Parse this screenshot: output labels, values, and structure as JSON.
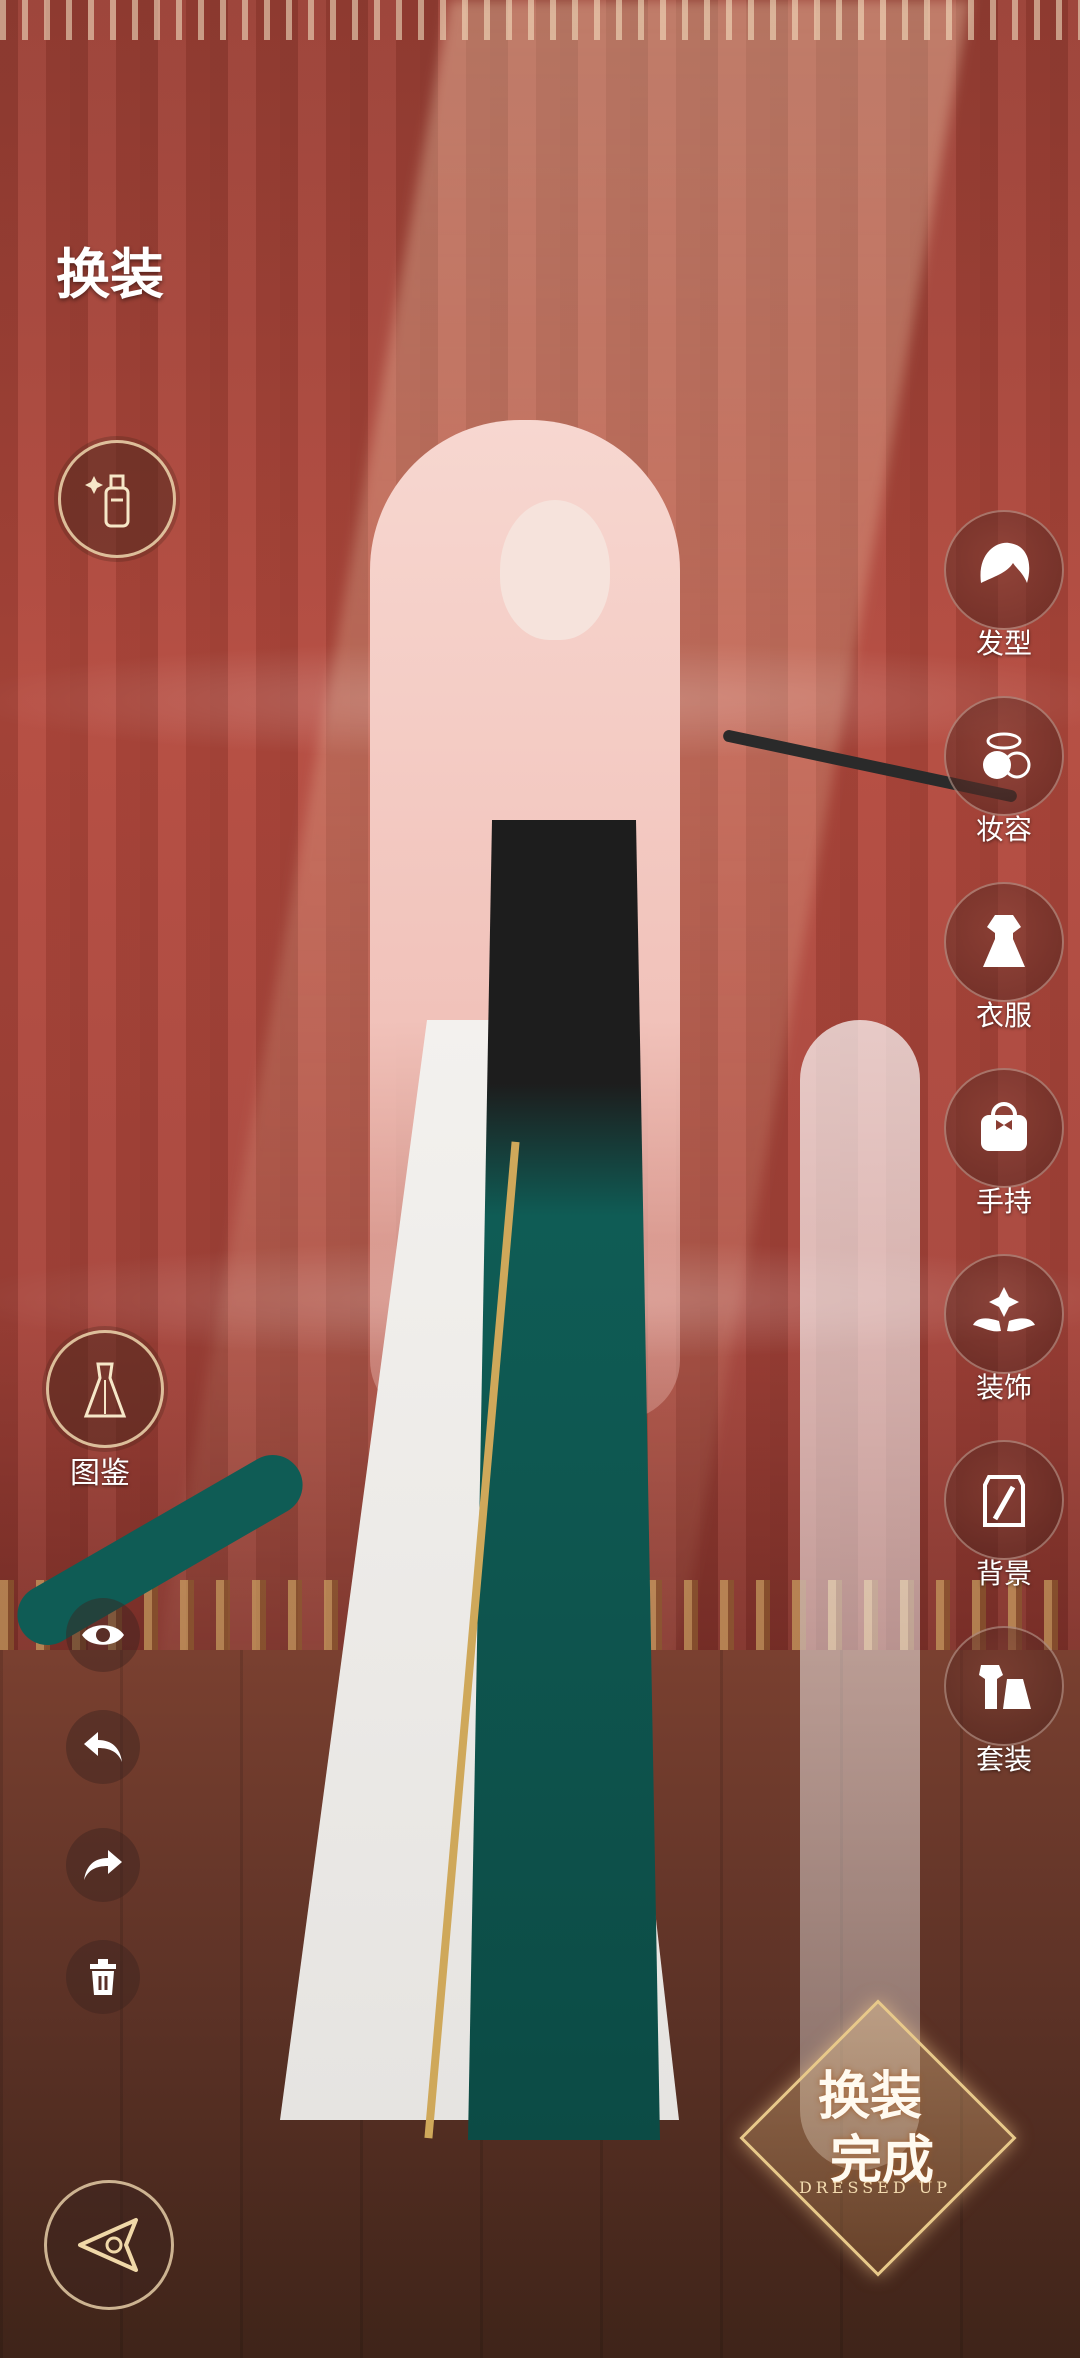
{
  "screen": {
    "title": "换装"
  },
  "left_panel": {
    "skincare_icon": "lotion-bottle-icon",
    "catalog_label": "图鉴"
  },
  "right_menu": [
    {
      "label": "发型",
      "icon": "hairstyle-icon"
    },
    {
      "label": "妆容",
      "icon": "makeup-icon"
    },
    {
      "label": "衣服",
      "icon": "dress-icon"
    },
    {
      "label": "手持",
      "icon": "handbag-icon"
    },
    {
      "label": "装饰",
      "icon": "wings-ornament-icon"
    },
    {
      "label": "背景",
      "icon": "background-icon"
    },
    {
      "label": "套装",
      "icon": "outfit-set-icon"
    }
  ],
  "tools": {
    "view": "eye-icon",
    "undo": "undo-icon",
    "redo": "redo-icon",
    "delete": "trash-icon"
  },
  "done_badge": {
    "line1": "换装",
    "line2": "完成",
    "subtitle": "DRESSED UP"
  },
  "colors": {
    "accent_gold": "#e8c98a",
    "curtain_red": "#b4493d",
    "dress_teal": "#0f5c55"
  }
}
